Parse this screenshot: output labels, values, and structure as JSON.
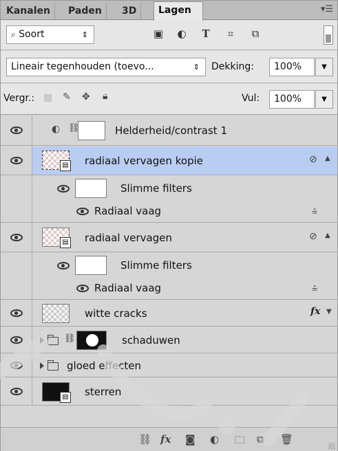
{
  "tabs": [
    {
      "label": "Kanalen"
    },
    {
      "label": "Paden"
    },
    {
      "label": "3D"
    },
    {
      "label": "Lagen"
    }
  ],
  "filter": {
    "kind_label": "Soort",
    "search_icon": "search-icon"
  },
  "blend": {
    "mode": "Lineair tegenhouden (toevo...",
    "opacity_label": "Dekking:",
    "opacity_value": "100%"
  },
  "lock": {
    "label": "Vergr.:",
    "fill_label": "Vul:",
    "fill_value": "100%"
  },
  "layers": [
    {
      "name": "Helderheid/contrast 1"
    },
    {
      "name": "radiaal vervagen kopie"
    },
    {
      "name": "Slimme filters"
    },
    {
      "name": "Radiaal vaag"
    },
    {
      "name": "radiaal vervagen"
    },
    {
      "name": "Slimme filters"
    },
    {
      "name": "Radiaal vaag"
    },
    {
      "name": "witte cracks",
      "fx": "fx"
    },
    {
      "name": "schaduwen"
    },
    {
      "name": "gloed effecten"
    },
    {
      "name": "sterren"
    }
  ],
  "bottom": {
    "fx_label": "fx"
  }
}
